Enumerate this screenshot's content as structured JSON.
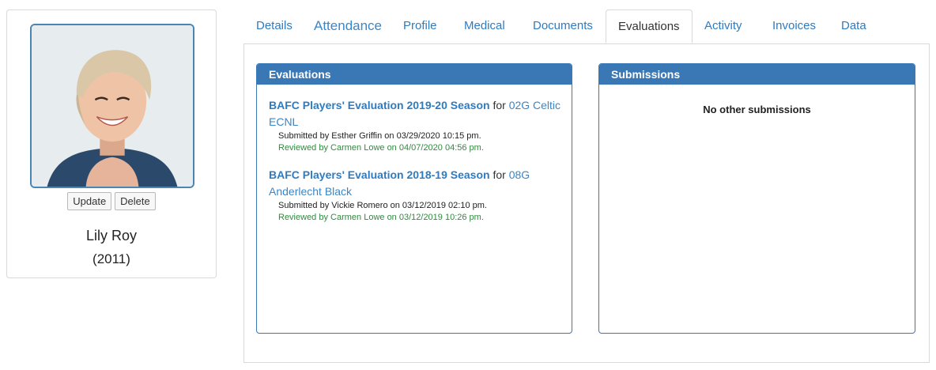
{
  "profile": {
    "name": "Lily Roy",
    "year": "(2011)",
    "update_label": "Update",
    "delete_label": "Delete"
  },
  "tabs": [
    {
      "label": "Details"
    },
    {
      "label": "Attendance"
    },
    {
      "label": "Profile"
    },
    {
      "label": "Medical"
    },
    {
      "label": "Documents"
    },
    {
      "label": "Evaluations"
    },
    {
      "label": "Activity"
    },
    {
      "label": "Invoices"
    },
    {
      "label": "Data"
    }
  ],
  "evaluations_panel": {
    "title": "Evaluations",
    "items": [
      {
        "title": "BAFC Players' Evaluation 2019-20 Season",
        "for": "for",
        "team": "02G Celtic ECNL",
        "submitted": "Submitted by Esther Griffin on 03/29/2020 10:15 pm.",
        "reviewed": "Reviewed by Carmen Lowe on 04/07/2020 04:56 pm."
      },
      {
        "title": "BAFC Players' Evaluation 2018-19 Season",
        "for": "for",
        "team": "08G Anderlecht Black",
        "submitted": "Submitted by Vickie Romero on 03/12/2019 02:10 pm.",
        "reviewed": "Reviewed by Carmen Lowe on 03/12/2019 10:26 pm."
      }
    ]
  },
  "submissions_panel": {
    "title": "Submissions",
    "empty_text": "No other submissions"
  },
  "colors": {
    "accent": "#3a78b5",
    "link": "#2f7bbf",
    "reviewed": "#2e8b3e"
  }
}
